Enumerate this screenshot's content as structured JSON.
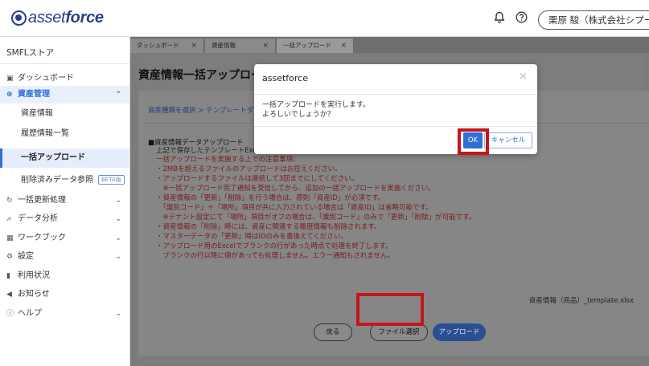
{
  "header": {
    "logo_text": "asset",
    "logo_bold": "force",
    "bell_icon": "bell-icon",
    "help_icon": "help-icon",
    "user_name": "栗原 駿（株式会社シプー）",
    "dropdown_icon": "chevron-down-icon"
  },
  "sidebar": {
    "store": "SMFLストア",
    "items": [
      {
        "label": "ダッシュボード",
        "icon": "dashboard-icon"
      },
      {
        "label": "資産管理",
        "icon": "asset-icon"
      },
      {
        "label": "資産情報"
      },
      {
        "label": "履歴情報一覧"
      },
      {
        "label": "一括アップロード"
      },
      {
        "label": "削除済みデータ参照",
        "badge": "BETA版"
      },
      {
        "label": "一括更新処理",
        "icon": "refresh-icon"
      },
      {
        "label": "データ分析",
        "icon": "analysis-icon"
      },
      {
        "label": "ワークブック",
        "icon": "workbook-icon"
      },
      {
        "label": "設定",
        "icon": "gear-icon"
      },
      {
        "label": "利用状況",
        "icon": "chart-icon"
      },
      {
        "label": "お知らせ",
        "icon": "megaphone-icon"
      },
      {
        "label": "ヘルプ",
        "icon": "help-icon"
      }
    ]
  },
  "tabs": [
    {
      "label": "ダッシュボード"
    },
    {
      "label": "資産情報"
    },
    {
      "label": "一括アップロード"
    }
  ],
  "main": {
    "page_title": "資産情報一括アップロード",
    "breadcrumb": "資産種類を選択 > テンプレートダウンロード",
    "section_title": "■資産情報データアップロード",
    "lines": [
      {
        "text": "上記で保存したテンプレートExcel",
        "tone": "dark"
      },
      {
        "text": "一括アップロードを実施する上での注意事項：",
        "tone": "red"
      },
      {
        "text": "・2MBを超えるファイルのアップロードはお控えください。",
        "tone": "red"
      },
      {
        "text": "・アップロードするファイルは連続して3回までにしてください。",
        "tone": "red"
      },
      {
        "text": "　※一括アップロード完了通知を受信してから、追加の一括アップロードを実施ください。",
        "tone": "red"
      },
      {
        "text": "・資産情報の「更新」「削除」を行う場合は、原則「資産ID」が必須です。",
        "tone": "red"
      },
      {
        "text": "　「識別コード」＋「場所」項目が共に入力されている場合は「資産ID」は省略可能です。",
        "tone": "red"
      },
      {
        "text": "　※テナント設定にて「場所」項目がオフの場合は、「識別コード」のみで「更新」「削除」が可能です。",
        "tone": "red"
      },
      {
        "text": "・資産情報の「削除」時には、資産に関連する履歴情報も削除されます。",
        "tone": "red"
      },
      {
        "text": "・マスターデータの「更新」時はIDのみを書換えてください。",
        "tone": "red"
      },
      {
        "text": "・アップロード用のExcelでブランクの行があった時点で処理を終了します。",
        "tone": "red"
      },
      {
        "text": "　ブランクの行以降に値があっても処理しません。エラー通知もされません。",
        "tone": "red"
      }
    ],
    "filename": "資産情報（商品）_template.xlsx",
    "back_button": "戻る",
    "file_select_button": "ファイル選択",
    "upload_button": "アップロード"
  },
  "dialog": {
    "title": "assetforce",
    "message_line1": "一括アップロードを実行します。",
    "message_line2": "よろしいでしょうか？",
    "ok_button": "OK",
    "cancel_button": "キャンセル",
    "close_icon": "close-icon"
  },
  "colors": {
    "brand": "#2b3e8c",
    "accent": "#2f6fd6",
    "highlight": "#c4161c"
  }
}
